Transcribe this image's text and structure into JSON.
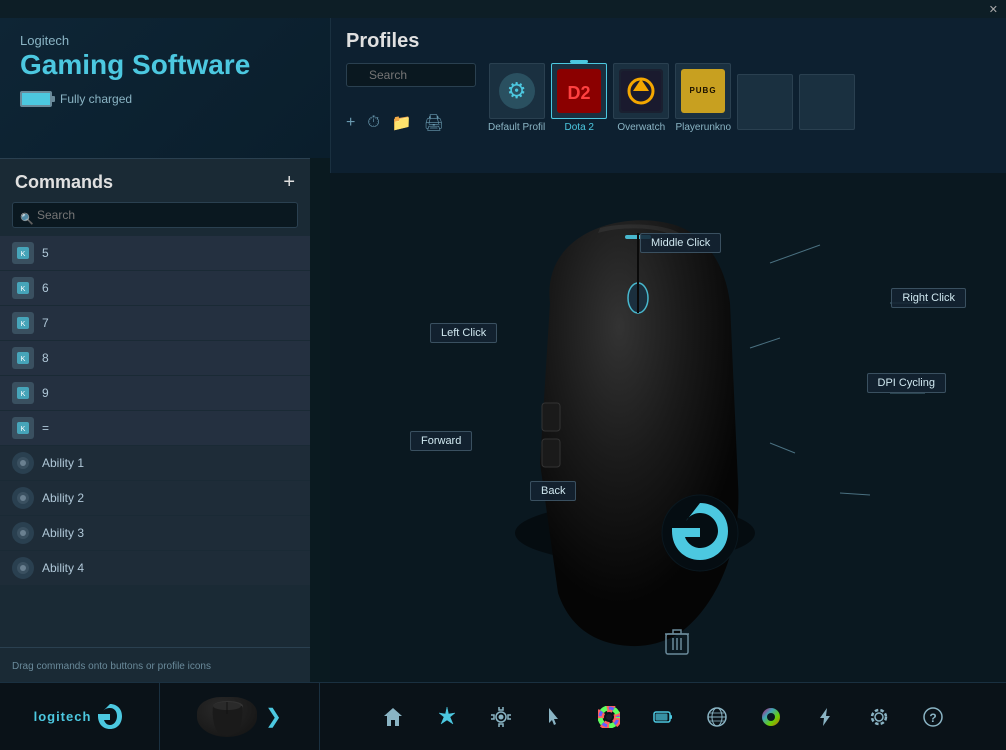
{
  "app": {
    "brand": "Logitech",
    "title": "Gaming Software",
    "battery_label": "Fully charged",
    "close_label": "✕"
  },
  "profiles": {
    "section_title": "Profiles",
    "search_placeholder": "Search",
    "items": [
      {
        "id": "default",
        "label": "Default Profil",
        "active": false,
        "type": "gear"
      },
      {
        "id": "dota2",
        "label": "Dota 2",
        "active": true,
        "type": "dota"
      },
      {
        "id": "overwatch",
        "label": "Overwatch",
        "active": false,
        "type": "ow"
      },
      {
        "id": "pubg",
        "label": "Playerunkno",
        "active": false,
        "type": "pubg"
      },
      {
        "id": "blank1",
        "label": "",
        "active": false,
        "type": "blank"
      },
      {
        "id": "blank2",
        "label": "",
        "active": false,
        "type": "blank"
      }
    ],
    "toolbar": {
      "add": "+",
      "clock": "⏱",
      "folder": "📁",
      "print": "🖨"
    }
  },
  "commands": {
    "title": "Commands",
    "add_label": "+",
    "search_placeholder": "Search",
    "footer_text": "Drag commands onto buttons or profile icons",
    "items": [
      {
        "id": "5",
        "label": "5",
        "type": "key"
      },
      {
        "id": "6",
        "label": "6",
        "type": "key"
      },
      {
        "id": "7",
        "label": "7",
        "type": "key"
      },
      {
        "id": "8",
        "label": "8",
        "type": "key"
      },
      {
        "id": "9",
        "label": "9",
        "type": "key"
      },
      {
        "id": "eq",
        "label": "=",
        "type": "key"
      },
      {
        "id": "ability1",
        "label": "Ability 1",
        "type": "ability"
      },
      {
        "id": "ability2",
        "label": "Ability 2",
        "type": "ability"
      },
      {
        "id": "ability3",
        "label": "Ability 3",
        "type": "ability"
      },
      {
        "id": "ability4",
        "label": "Ability 4",
        "type": "ability"
      }
    ]
  },
  "mouse_labels": {
    "middle_click": "Middle Click",
    "right_click": "Right Click",
    "left_click": "Left Click",
    "dpi_cycling": "DPI Cycling",
    "forward": "Forward",
    "back": "Back"
  },
  "bottom_bar": {
    "brand_text": "logitech",
    "brand_g": "G",
    "arrow": "❯",
    "icons": [
      {
        "id": "home",
        "symbol": "⌂",
        "label": "home-icon"
      },
      {
        "id": "sparkle",
        "symbol": "✦",
        "label": "sparkle-icon"
      },
      {
        "id": "settings2",
        "symbol": "⚙",
        "label": "settings-small-icon"
      },
      {
        "id": "cursor",
        "symbol": "↖",
        "label": "cursor-icon"
      },
      {
        "id": "color",
        "symbol": "◉",
        "label": "color-icon"
      },
      {
        "id": "battery2",
        "symbol": "⚡",
        "label": "battery2-icon"
      },
      {
        "id": "globe",
        "symbol": "⊕",
        "label": "globe-icon"
      },
      {
        "id": "spectrum",
        "symbol": "◈",
        "label": "spectrum-icon"
      },
      {
        "id": "lightning",
        "symbol": "⚡",
        "label": "lightning-icon"
      },
      {
        "id": "gear",
        "symbol": "⚙",
        "label": "gear-icon"
      },
      {
        "id": "question",
        "symbol": "?",
        "label": "help-icon"
      }
    ]
  }
}
